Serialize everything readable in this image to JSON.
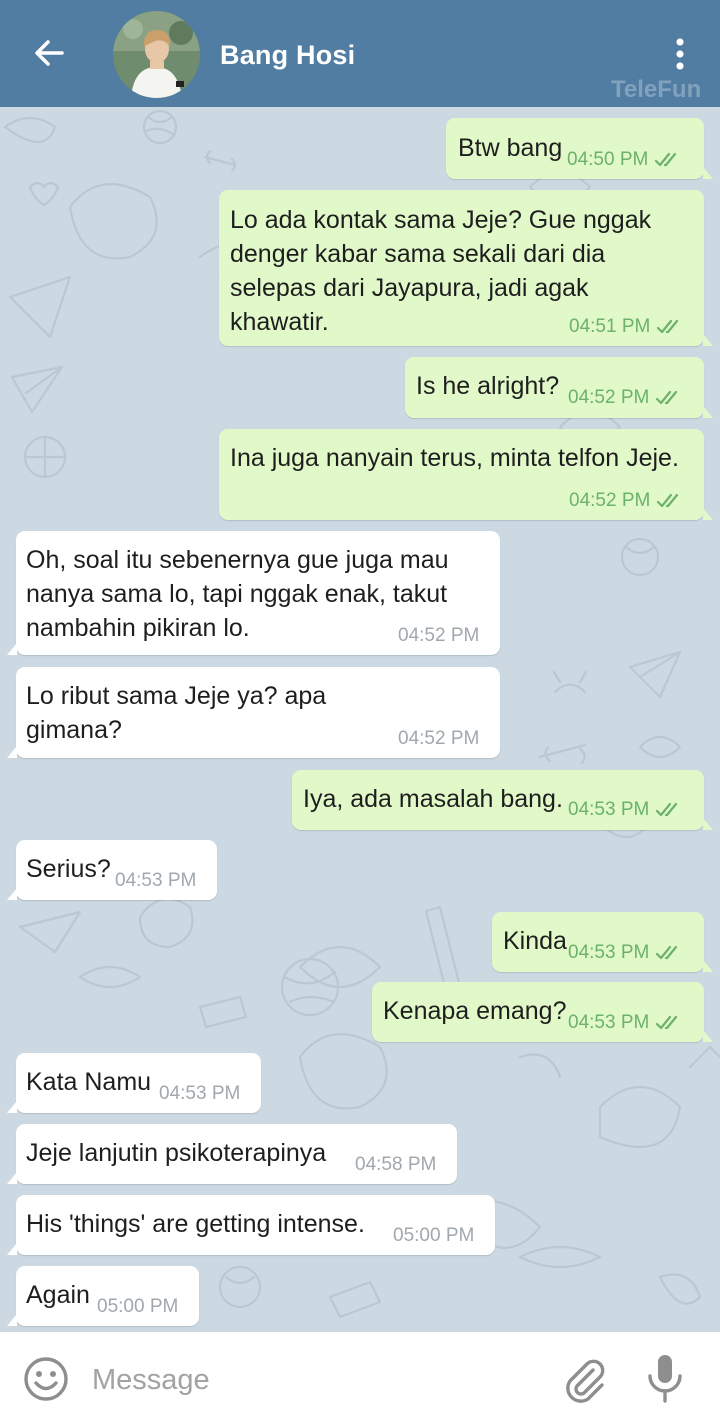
{
  "header": {
    "contact_name": "Bang Hosi",
    "watermark": "TeleFun",
    "back_icon": "arrow-left-icon",
    "menu_icon": "more-vertical-icon"
  },
  "messages": [
    {
      "dir": "out",
      "text": "Btw bang",
      "time": "04:50 PM",
      "read": true
    },
    {
      "dir": "out",
      "text": "Lo ada kontak sama Jeje? Gue nggak denger kabar sama sekali dari dia selepas dari Jayapura, jadi agak khawatir.",
      "time": "04:51 PM",
      "read": true
    },
    {
      "dir": "out",
      "text": "Is he alright?",
      "time": "04:52 PM",
      "read": true
    },
    {
      "dir": "out",
      "text": "Ina juga nanyain terus, minta telfon Jeje.",
      "time": "04:52 PM",
      "read": true
    },
    {
      "dir": "in",
      "text": "Oh, soal itu sebenernya gue juga mau nanya sama lo, tapi nggak enak, takut nambahin pikiran lo.",
      "time": "04:52 PM"
    },
    {
      "dir": "in",
      "text": "Lo ribut sama Jeje ya? apa gimana?",
      "time": "04:52 PM"
    },
    {
      "dir": "out",
      "text": "Iya, ada masalah bang.",
      "time": "04:53 PM",
      "read": true
    },
    {
      "dir": "in",
      "text": "Serius?",
      "time": "04:53 PM"
    },
    {
      "dir": "out",
      "text": "Kinda",
      "time": "04:53 PM",
      "read": true
    },
    {
      "dir": "out",
      "text": "Kenapa emang?",
      "time": "04:53 PM",
      "read": true
    },
    {
      "dir": "in",
      "text": "Kata Namu",
      "time": "04:53 PM"
    },
    {
      "dir": "in",
      "text": "Jeje lanjutin psikoterapinya",
      "time": "04:58 PM"
    },
    {
      "dir": "in",
      "text": "His 'things' are getting intense.",
      "time": "05:00 PM"
    },
    {
      "dir": "in",
      "text": "Again",
      "time": "05:00 PM"
    }
  ],
  "composer": {
    "placeholder": "Message",
    "emoji_icon": "emoji-icon",
    "attach_icon": "paperclip-icon",
    "mic_icon": "microphone-icon"
  },
  "colors": {
    "header": "#517da2",
    "outgoing_bubble": "#e1f8c9",
    "incoming_bubble": "#ffffff",
    "chat_background": "#ccd9e2",
    "check": "#6cb26a"
  }
}
